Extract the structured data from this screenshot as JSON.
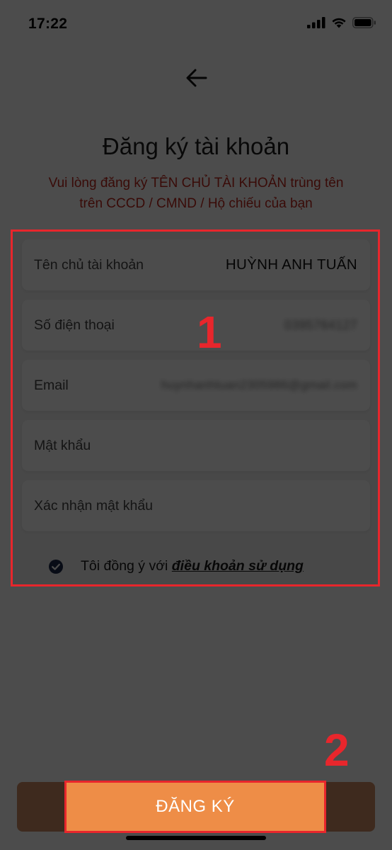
{
  "status_bar": {
    "time": "17:22",
    "icons": [
      "signal-icon",
      "wifi-icon",
      "battery-icon"
    ]
  },
  "header": {
    "back_icon": "arrow-left-icon",
    "title": "Đăng ký tài khoản",
    "subtitle_line1": "Vui lòng đăng ký TÊN CHỦ TÀI KHOẢN trùng tên",
    "subtitle_line2": "trên CCCD / CMND / Hộ chiếu của bạn"
  },
  "form": {
    "fields": [
      {
        "label": "Tên chủ tài khoản",
        "value": "HUỲNH ANH TUẤN"
      },
      {
        "label": "Số điện thoại",
        "value": "0395764127"
      },
      {
        "label": "Email",
        "value": "huynhanhtuan2305986@gmail.com"
      },
      {
        "label": "Mật khẩu",
        "value": ""
      },
      {
        "label": "Xác nhận mật khẩu",
        "value": ""
      }
    ],
    "agree_prefix": "Tôi đồng ý với",
    "agree_link": "điều khoản sử dụng"
  },
  "annotations": {
    "step1": "1",
    "step2": "2",
    "highlight_color": "#e8262c"
  },
  "footer": {
    "register_label": "ĐĂNG KÝ"
  },
  "colors": {
    "accent": "#ee8d47",
    "subtitle": "#c0271d",
    "dark_bar": "#3e2a1e"
  }
}
